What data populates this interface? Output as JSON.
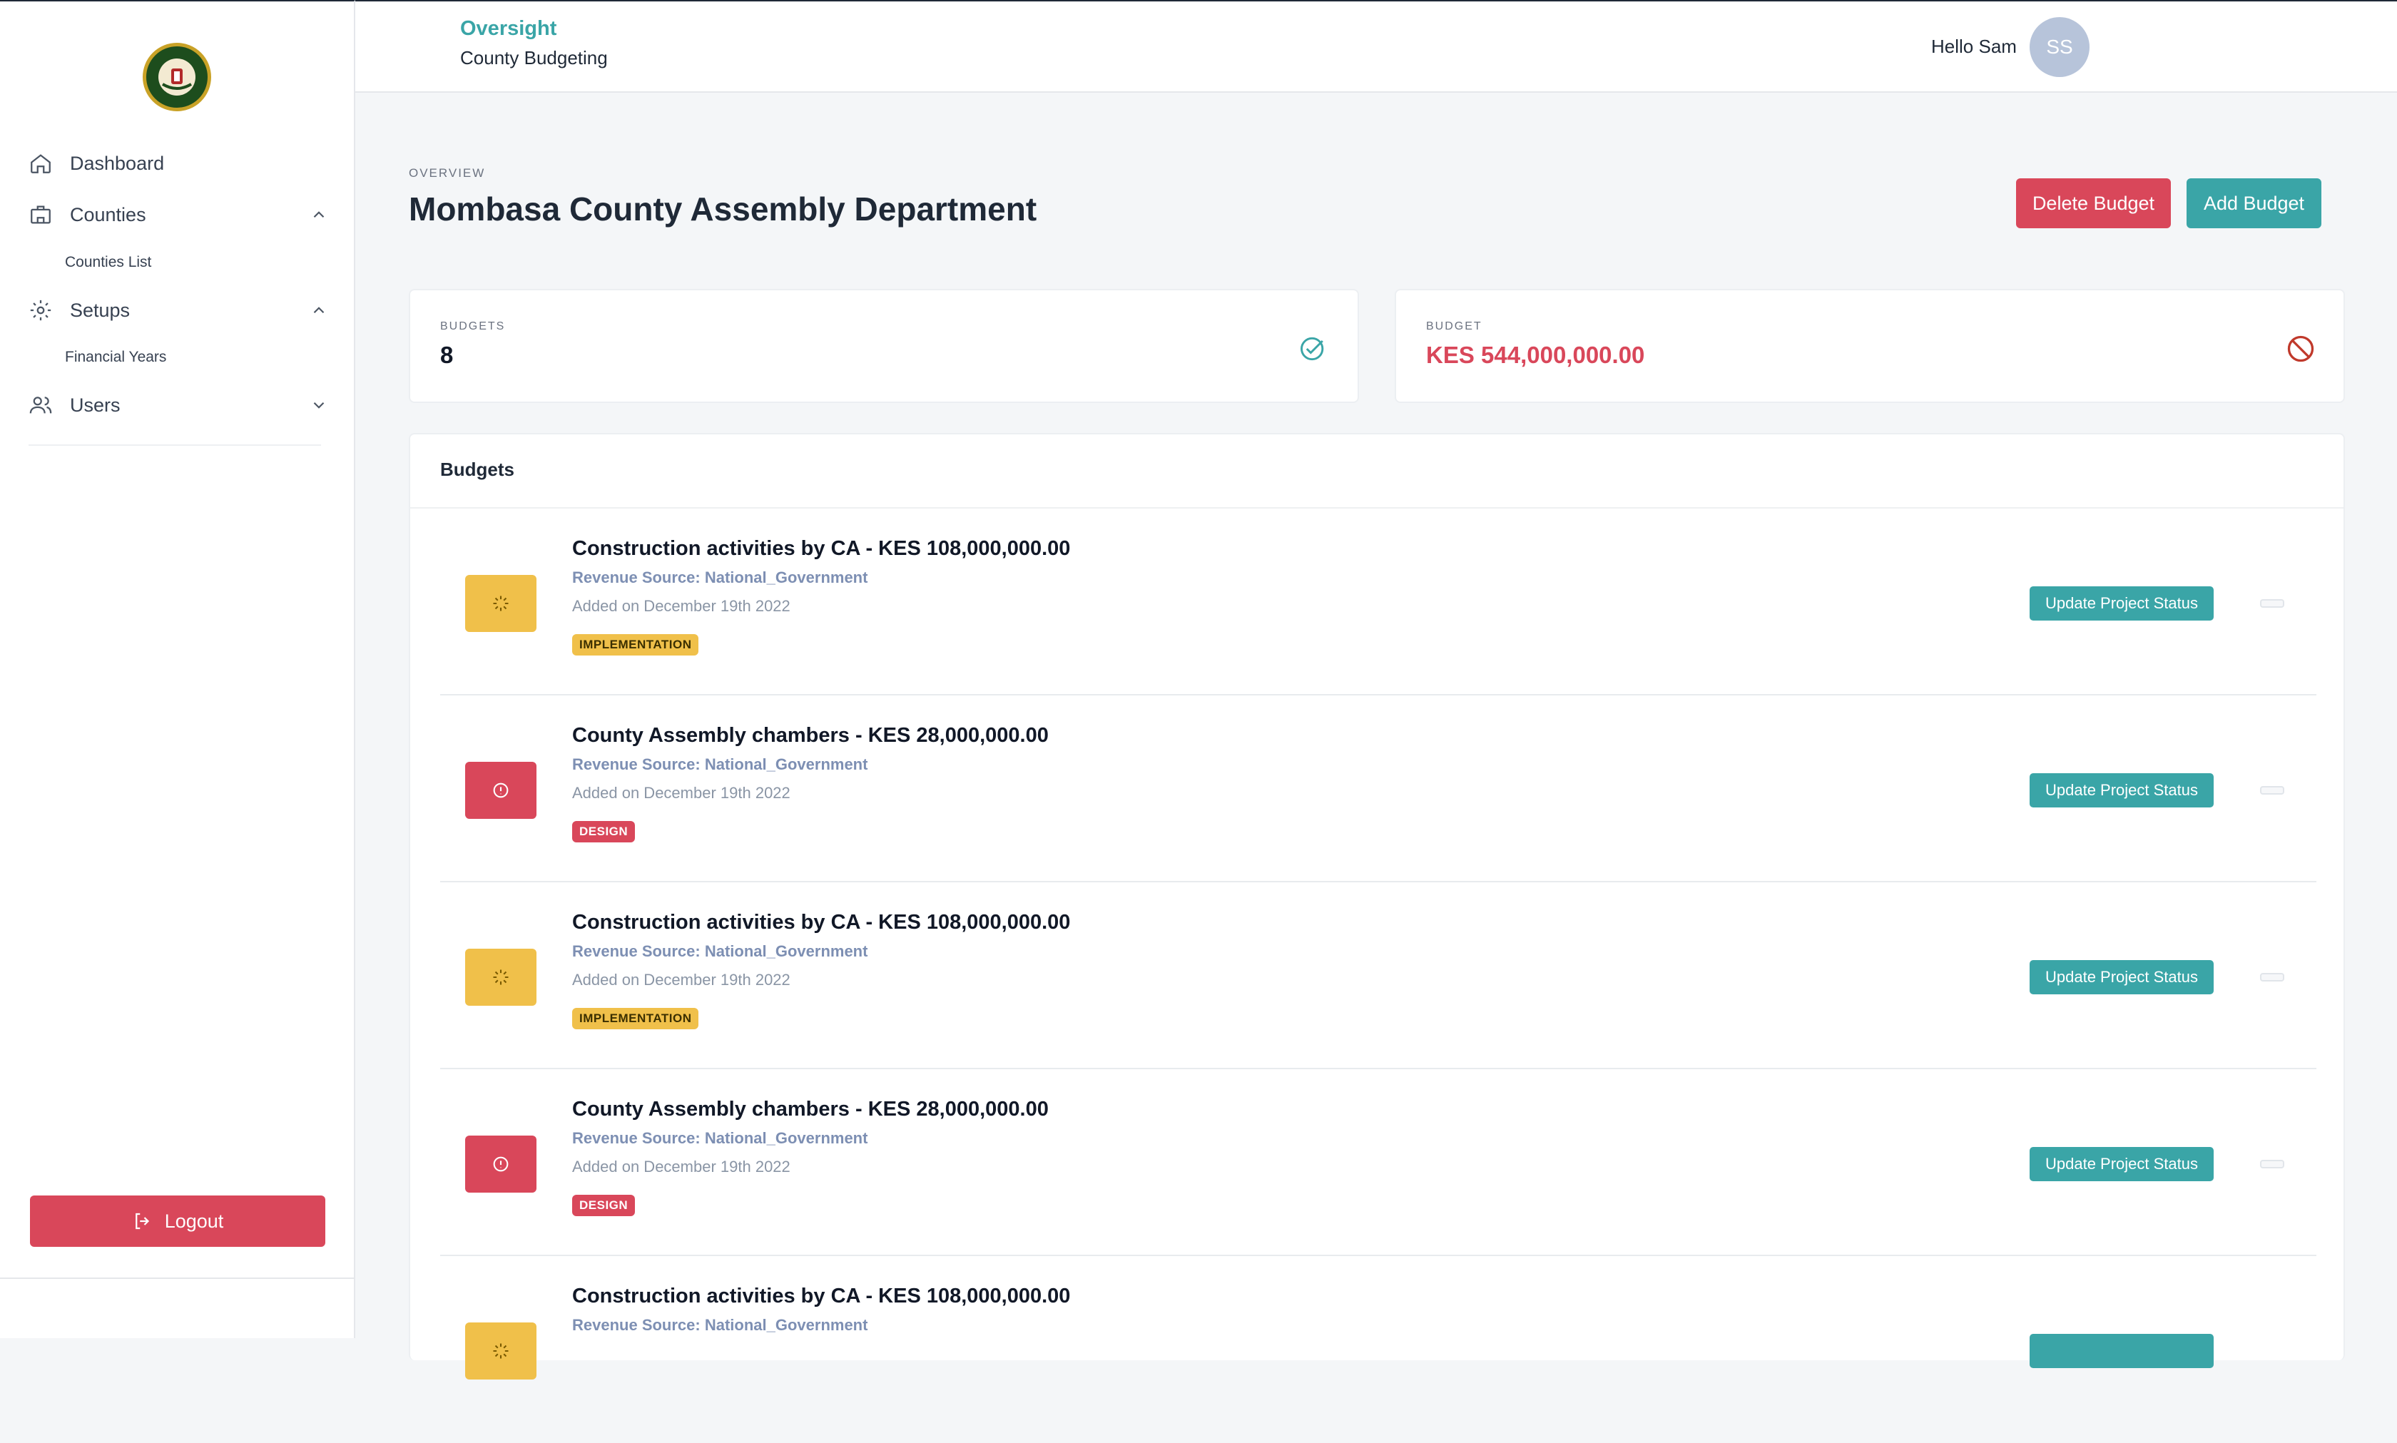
{
  "app": {
    "brand": "Oversight",
    "section": "County Budgeting",
    "greeting": "Hello Sam",
    "avatar_initials": "SS"
  },
  "sidebar": {
    "items": [
      {
        "label": "Dashboard",
        "icon": "home-icon"
      },
      {
        "label": "Counties",
        "icon": "building-icon",
        "chevron": "up"
      },
      {
        "label": "Counties List",
        "sub": true
      },
      {
        "label": "Setups",
        "icon": "gear-icon",
        "chevron": "up"
      },
      {
        "label": "Financial Years",
        "sub": true
      },
      {
        "label": "Users",
        "icon": "users-icon",
        "chevron": "down"
      }
    ],
    "logout_label": "Logout"
  },
  "page": {
    "eyebrow": "OVERVIEW",
    "title": "Mombasa County Assembly Department",
    "delete_label": "Delete Budget",
    "add_label": "Add Budget"
  },
  "stats": {
    "budgets_label": "BUDGETS",
    "budgets_value": "8",
    "budget_label": "BUDGET",
    "budget_value": "KES 544,000,000.00"
  },
  "list": {
    "title": "Budgets",
    "action_label": "Update Project Status",
    "rows": [
      {
        "title": "Construction activities by CA - KES 108,000,000.00",
        "source": "Revenue Source: National_Government",
        "date": "Added on December 19th 2022",
        "status": "IMPLEMENTATION",
        "tile": "spinner-icon"
      },
      {
        "title": "County Assembly chambers - KES 28,000,000.00",
        "source": "Revenue Source: National_Government",
        "date": "Added on December 19th 2022",
        "status": "DESIGN",
        "tile": "alert-circle-icon"
      },
      {
        "title": "Construction activities by CA - KES 108,000,000.00",
        "source": "Revenue Source: National_Government",
        "date": "Added on December 19th 2022",
        "status": "IMPLEMENTATION",
        "tile": "spinner-icon"
      },
      {
        "title": "County Assembly chambers - KES 28,000,000.00",
        "source": "Revenue Source: National_Government",
        "date": "Added on December 19th 2022",
        "status": "DESIGN",
        "tile": "alert-circle-icon"
      },
      {
        "title": "Construction activities by CA - KES 108,000,000.00",
        "source": "Revenue Source: National_Government",
        "date": "",
        "status": "",
        "tile": "spinner-icon"
      }
    ]
  },
  "colors": {
    "accent": "#3aa5a7",
    "danger": "#d9475a",
    "warning": "#f0c04a"
  }
}
